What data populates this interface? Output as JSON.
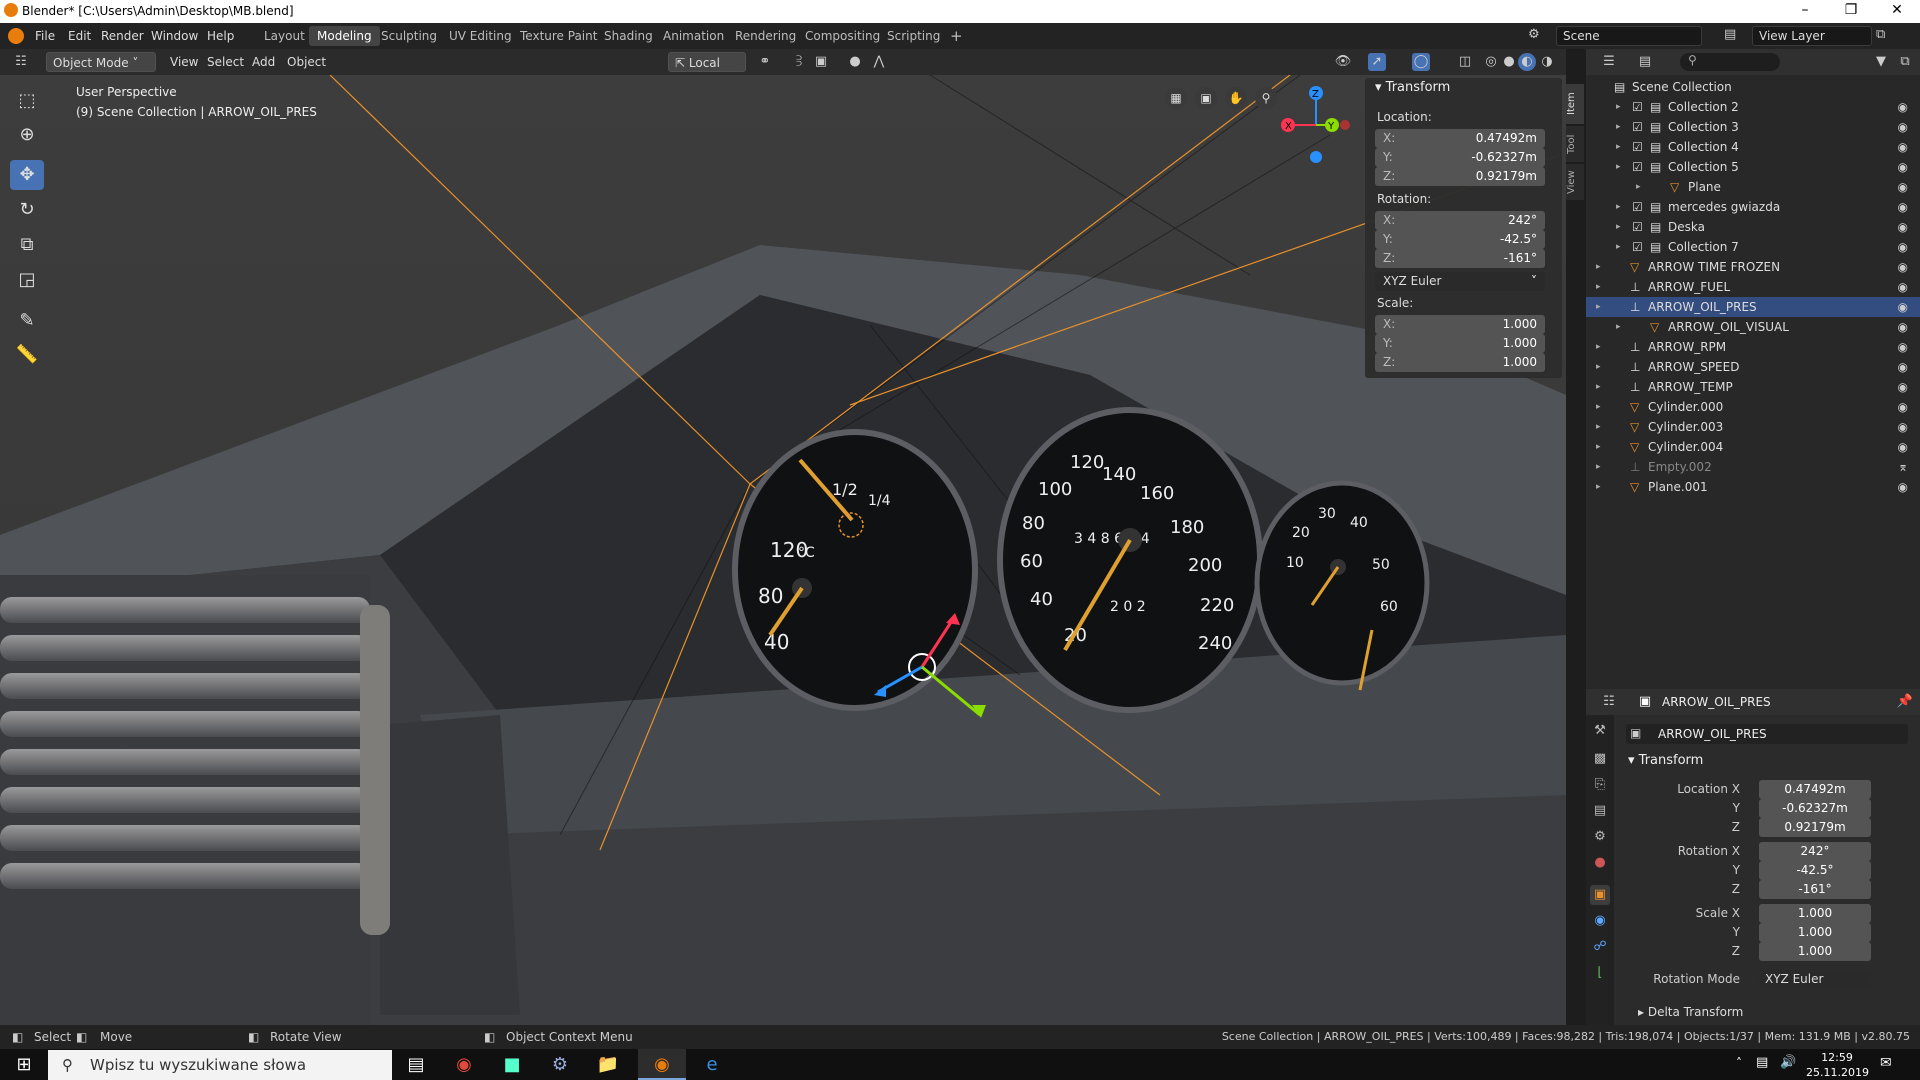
{
  "window": {
    "title": "Blender* [C:\\Users\\Admin\\Desktop\\MB.blend]"
  },
  "menu": [
    "File",
    "Edit",
    "Render",
    "Window",
    "Help"
  ],
  "workspaces": [
    "Layout",
    "Modeling",
    "Sculpting",
    "UV Editing",
    "Texture Paint",
    "Shading",
    "Animation",
    "Rendering",
    "Compositing",
    "Scripting"
  ],
  "active_workspace": "Modeling",
  "scene_name": "Scene",
  "view_layer": "View Layer",
  "viewport_header": {
    "mode": "Object Mode",
    "menus": [
      "View",
      "Select",
      "Add",
      "Object"
    ],
    "orientation": "Local"
  },
  "viewport": {
    "info_line1": "User Perspective",
    "info_line2": "(9) Scene Collection | ARROW_OIL_PRES",
    "axis_x": "X",
    "axis_y": "Y",
    "axis_z": "Z"
  },
  "npanel": {
    "header": "Transform",
    "location_label": "Location:",
    "loc": {
      "x": "0.47492m",
      "y": "-0.62327m",
      "z": "0.92179m"
    },
    "rotation_label": "Rotation:",
    "rot": {
      "x": "242°",
      "y": "-42.5°",
      "z": "-161°"
    },
    "rot_mode": "XYZ Euler",
    "scale_label": "Scale:",
    "scale": {
      "x": "1.000",
      "y": "1.000",
      "z": "1.000"
    },
    "k_x": "X:",
    "k_y": "Y:",
    "k_z": "Z:",
    "tabs": [
      "Item",
      "Tool",
      "View"
    ]
  },
  "outliner": {
    "root": "Scene Collection",
    "rows": [
      {
        "label": "Collection 2"
      },
      {
        "label": "Collection 3"
      },
      {
        "label": "Collection 4"
      },
      {
        "label": "Collection 5"
      },
      {
        "label": "Plane"
      },
      {
        "label": "mercedes gwiazda"
      },
      {
        "label": "Deska"
      },
      {
        "label": "Collection 7"
      },
      {
        "label": "ARROW TIME FROZEN"
      },
      {
        "label": "ARROW_FUEL"
      },
      {
        "label": "ARROW_OIL_PRES"
      },
      {
        "label": "ARROW_OIL_VISUAL"
      },
      {
        "label": "ARROW_RPM"
      },
      {
        "label": "ARROW_SPEED"
      },
      {
        "label": "ARROW_TEMP"
      },
      {
        "label": "Cylinder.000"
      },
      {
        "label": "Cylinder.003"
      },
      {
        "label": "Cylinder.004"
      },
      {
        "label": "Empty.002"
      },
      {
        "label": "Plane.001"
      }
    ]
  },
  "properties": {
    "object_name": "ARROW_OIL_PRES",
    "data_name": "ARROW_OIL_PRES",
    "section": "Transform",
    "labels": {
      "loc_x": "Location X",
      "y": "Y",
      "z": "Z",
      "rot_x": "Rotation X",
      "scale_x": "Scale X",
      "rot_mode": "Rotation Mode"
    },
    "loc": {
      "x": "0.47492m",
      "y": "-0.62327m",
      "z": "0.92179m"
    },
    "rot": {
      "x": "242°",
      "y": "-42.5°",
      "z": "-161°"
    },
    "scale": {
      "x": "1.000",
      "y": "1.000",
      "z": "1.000"
    },
    "rot_mode": "XYZ Euler",
    "delta": "Delta Transform"
  },
  "statusbar": {
    "select": "Select",
    "move": "Move",
    "rotate": "Rotate View",
    "context": "Object Context Menu",
    "stats": "Scene Collection | ARROW_OIL_PRES | Verts:100,489 | Faces:98,282 | Tris:198,074 | Objects:1/37 | Mem: 131.9 MB | v2.80.75"
  },
  "taskbar": {
    "search_placeholder": "Wpisz tu wyszukiwane słowa",
    "time": "12:59",
    "date": "25.11.2019"
  },
  "gauges": {
    "temp_labels": [
      "120",
      "80",
      "40"
    ],
    "temp_unit": "°C",
    "fuel_labels": [
      "1/2",
      "1/4"
    ],
    "speed_labels": [
      "20",
      "40",
      "60",
      "80",
      "100",
      "120",
      "140",
      "160",
      "180",
      "200",
      "220",
      "240"
    ],
    "odo": "3 4 8 6 7 4",
    "trip": "2 0 2",
    "clock_labels": [
      "10",
      "20",
      "30",
      "40",
      "50",
      "60"
    ]
  },
  "colors": {
    "accent": "#4772b3",
    "selection": "#334d80",
    "orange": "#e87d0d"
  }
}
